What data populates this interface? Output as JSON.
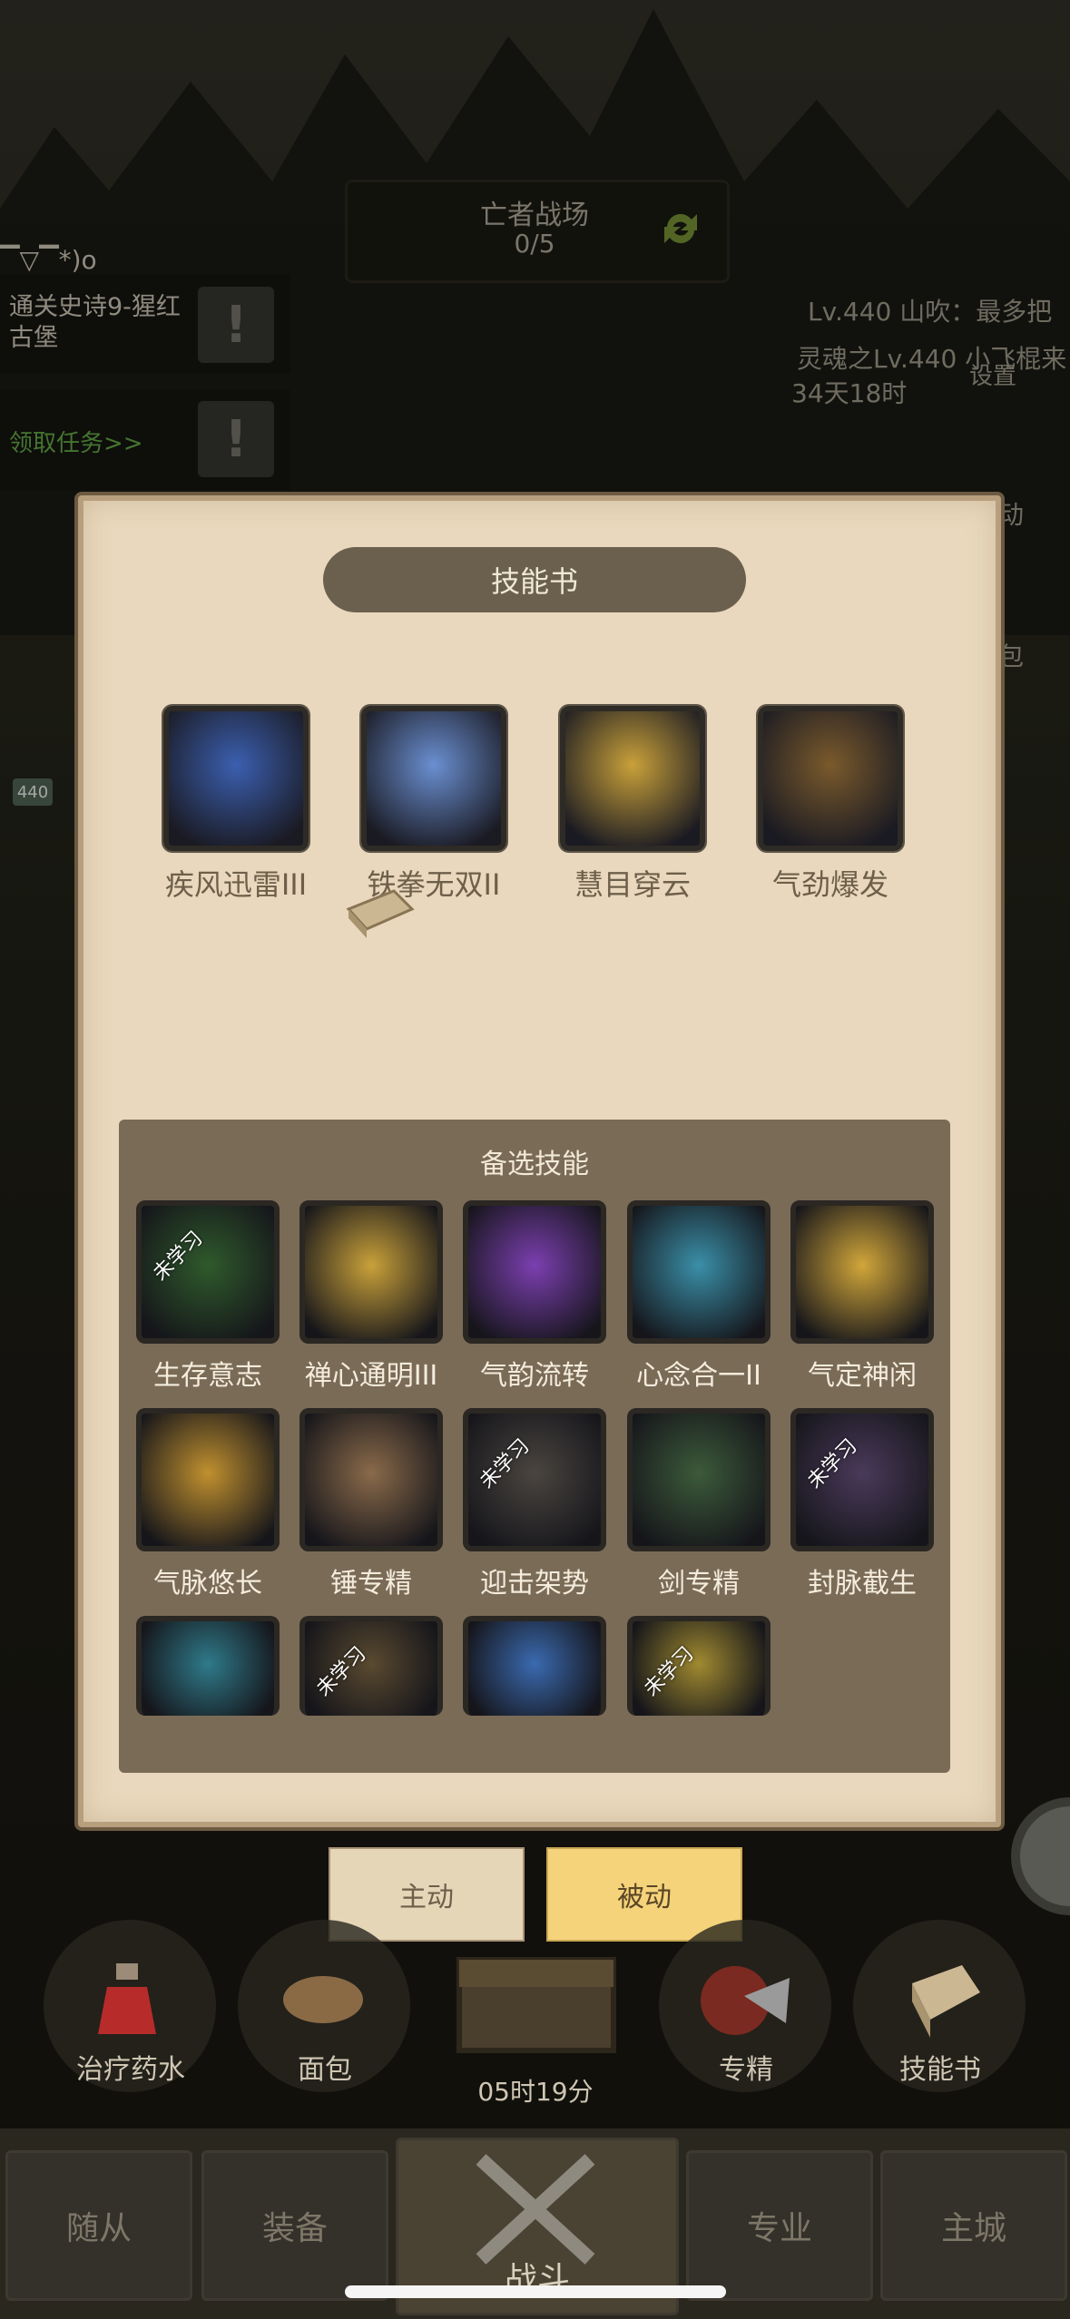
{
  "top": {
    "area_title": "亡者战场",
    "area_count": "0/5",
    "emote": "▔▽▔*)o",
    "quest1": "通关史诗9-猩红古堡",
    "quest2": "领取任务>>",
    "level_info": "Lv.440 山吹：最多把",
    "level_info2": "灵魂之Lv.440 小飞棍来",
    "timer": "34天18时",
    "settings_label": "设置",
    "side_label1": "动",
    "side_label2": "包",
    "badge_level": "440"
  },
  "modal": {
    "title": "技能书",
    "equipped_skills": [
      {
        "label": "疾风迅雷III",
        "icon": "wind-thunder-icon",
        "color": "#3b5fb0"
      },
      {
        "label": "铁拳无双II",
        "icon": "iron-fist-icon",
        "color": "#6a8fd1"
      },
      {
        "label": "慧目穿云",
        "icon": "eagle-icon",
        "color": "#c9a13a"
      },
      {
        "label": "气劲爆发",
        "icon": "qi-burst-icon",
        "color": "#7a5a2c"
      }
    ],
    "alt_title": "备选技能",
    "unlearned_text": "未学习",
    "alt_skills": [
      {
        "label": "生存意志",
        "icon": "vines-icon",
        "color": "#2f5a2c",
        "unlearned": true
      },
      {
        "label": "禅心通明III",
        "icon": "spiral-icon",
        "color": "#c9a13a",
        "unlearned": false
      },
      {
        "label": "气韵流转",
        "icon": "purple-swirl-icon",
        "color": "#7b3fb0",
        "unlearned": false
      },
      {
        "label": "心念合一II",
        "icon": "crystal-icon",
        "color": "#3a8fa8",
        "unlearned": false
      },
      {
        "label": "气定神闲",
        "icon": "golden-body-icon",
        "color": "#d1a63a",
        "unlearned": false
      },
      {
        "label": "气脉悠长",
        "icon": "golden-knot-icon",
        "color": "#c0902f",
        "unlearned": false
      },
      {
        "label": "锤专精",
        "icon": "hammer-icon",
        "color": "#8a6a4a",
        "unlearned": false
      },
      {
        "label": "迎击架势",
        "icon": "guard-stance-icon",
        "color": "#4a4540",
        "unlearned": true
      },
      {
        "label": "剑专精",
        "icon": "sword-icon",
        "color": "#3c5a3a",
        "unlearned": false
      },
      {
        "label": "封脉截生",
        "icon": "chain-icon",
        "color": "#4a3a5a",
        "unlearned": true
      },
      {
        "label": "",
        "icon": "water-splash-icon",
        "color": "#2f7a8a",
        "unlearned": false
      },
      {
        "label": "",
        "icon": "stone-fist-icon",
        "color": "#5a4a30",
        "unlearned": true
      },
      {
        "label": "",
        "icon": "blue-warrior-icon",
        "color": "#3a6ab0",
        "unlearned": false
      },
      {
        "label": "",
        "icon": "sun-eye-icon",
        "color": "#a08a30",
        "unlearned": true
      }
    ]
  },
  "tabs": {
    "active": "主动",
    "passive": "被动"
  },
  "bottom": {
    "potion": "治疗药水",
    "bread": "面包",
    "specialize": "专精",
    "skillbook": "技能书",
    "timer": "05时19分"
  },
  "nav": [
    "随从",
    "装备",
    "战斗",
    "专业",
    "主城"
  ]
}
